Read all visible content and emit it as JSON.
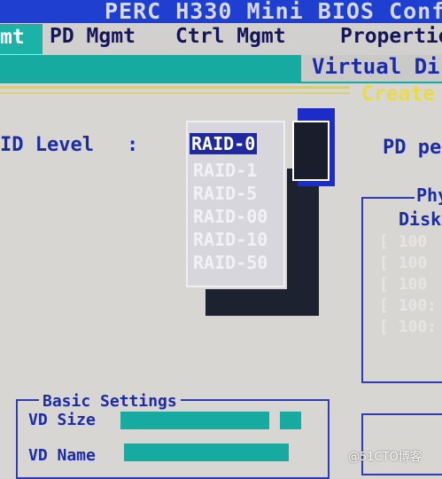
{
  "title": "PERC H330 Mini BIOS Conf",
  "menu": {
    "vd_mgmt": "mt",
    "pd_mgmt": "PD Mgmt",
    "ctrl_mgmt": "Ctrl Mgmt",
    "properties": "Propertie"
  },
  "panel": {
    "virtual_disk_tab": "Virtual Di",
    "create_label": "Create"
  },
  "raid": {
    "label": "ID Level",
    "colon": ":",
    "options": [
      "RAID-0",
      "RAID-1",
      "RAID-5",
      "RAID-00",
      "RAID-10",
      "RAID-50"
    ],
    "selected": "RAID-0"
  },
  "pd_per": "PD pe",
  "physical": {
    "label": "Phy",
    "disk_label": "Disk",
    "rows": [
      "[ 100",
      "[ 100",
      "[ 100",
      "[ 100:",
      "[ 100:"
    ]
  },
  "basic_settings": {
    "label": "Basic Settings",
    "vd_size_label": "VD Size",
    "vd_name_label": "VD Name"
  },
  "watermark": "@51CTO博客",
  "colors": {
    "title_bar": "#1e3fd0",
    "teal": "#17aaa0",
    "text_blue": "#1c2ba6",
    "yellow": "#e1d24a",
    "selection": "#1f2aa0"
  }
}
